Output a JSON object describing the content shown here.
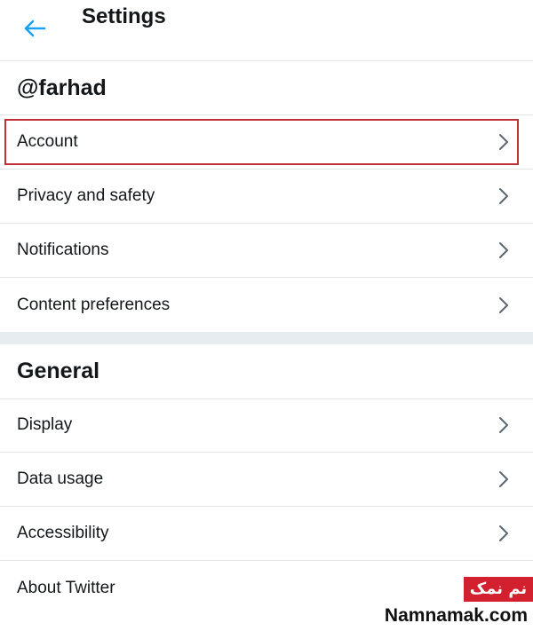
{
  "header": {
    "title": "Settings",
    "back_icon": "arrow-left-icon",
    "accent_color": "#1da1f2"
  },
  "account_section": {
    "title": "@farhad",
    "items": [
      {
        "label": "Account",
        "icon": "chevron-right-icon",
        "highlighted": true
      },
      {
        "label": "Privacy and safety",
        "icon": "chevron-right-icon"
      },
      {
        "label": "Notifications",
        "icon": "chevron-right-icon"
      },
      {
        "label": "Content preferences",
        "icon": "chevron-right-icon"
      }
    ]
  },
  "general_section": {
    "title": "General",
    "items": [
      {
        "label": "Display",
        "icon": "chevron-right-icon"
      },
      {
        "label": "Data usage",
        "icon": "chevron-right-icon"
      },
      {
        "label": "Accessibility",
        "icon": "chevron-right-icon"
      },
      {
        "label": "About Twitter"
      }
    ]
  },
  "watermark": {
    "badge_text": "نم نمک",
    "site_text": "Namnamak.com",
    "badge_color": "#d2202f"
  }
}
